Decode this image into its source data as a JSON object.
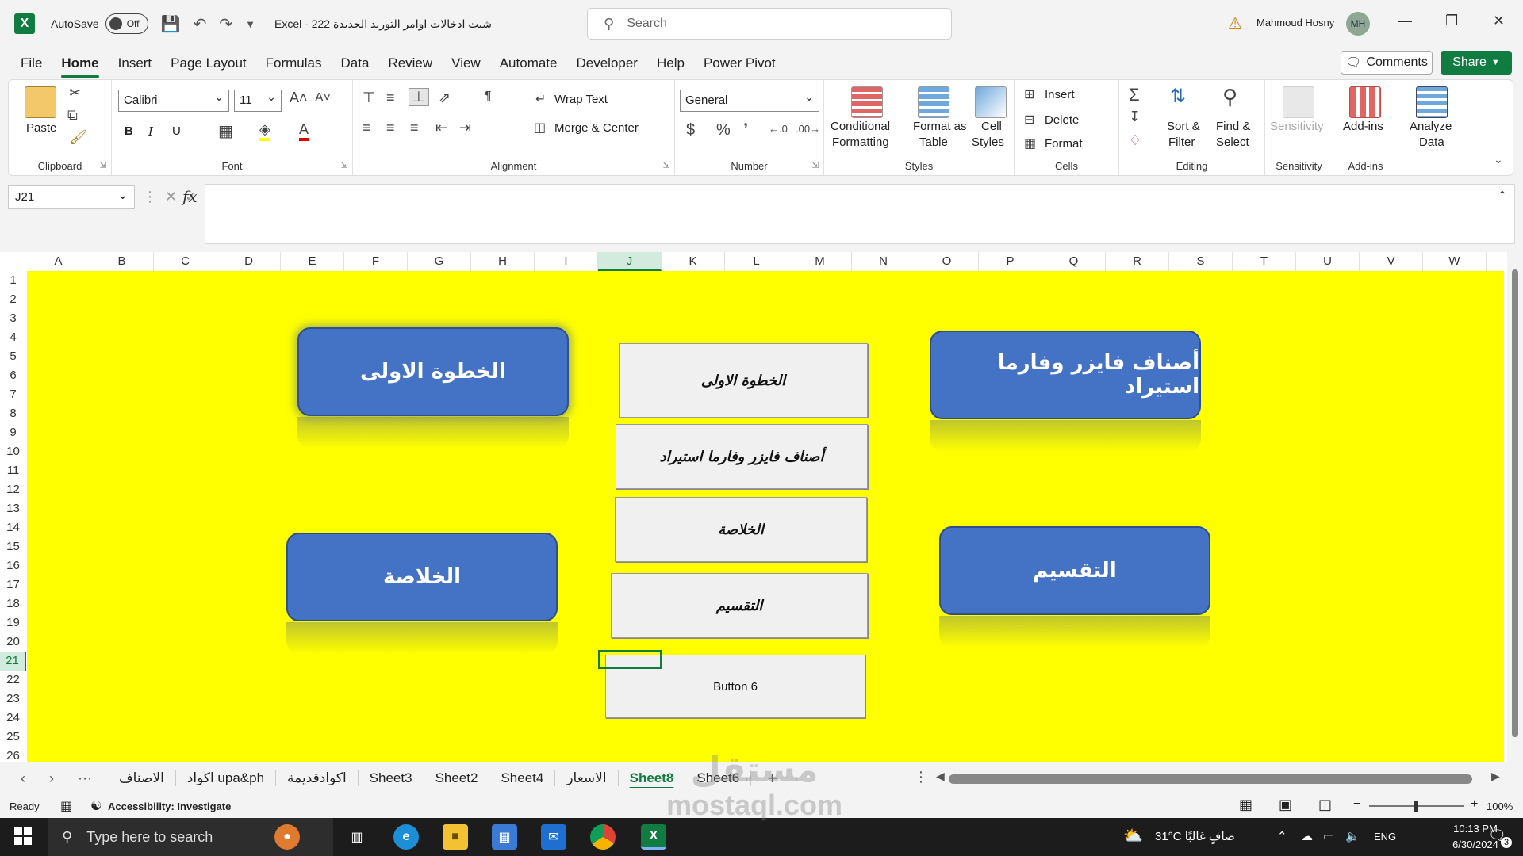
{
  "titlebar": {
    "autosave_label": "AutoSave",
    "autosave_state": "Off",
    "doc_title": "شيت ادخالات اوامر التوريد الجديدة 222  -  Excel",
    "search_placeholder": "Search",
    "user_name": "Mahmoud Hosny",
    "user_initials": "MH"
  },
  "menu": {
    "tabs": [
      "File",
      "Home",
      "Insert",
      "Page Layout",
      "Formulas",
      "Data",
      "Review",
      "View",
      "Automate",
      "Developer",
      "Help",
      "Power Pivot"
    ],
    "active": "Home",
    "comments": "Comments",
    "share": "Share"
  },
  "ribbon": {
    "clipboard": {
      "label": "Clipboard",
      "paste": "Paste"
    },
    "font": {
      "label": "Font",
      "name": "Calibri",
      "size": "11",
      "bold": "B",
      "italic": "I",
      "underline": "U"
    },
    "alignment": {
      "label": "Alignment",
      "wrap": "Wrap Text",
      "merge": "Merge & Center"
    },
    "number": {
      "label": "Number",
      "format": "General"
    },
    "styles": {
      "label": "Styles",
      "conditional_1": "Conditional",
      "conditional_2": "Formatting",
      "table_1": "Format as",
      "table_2": "Table",
      "cell_1": "Cell",
      "cell_2": "Styles"
    },
    "cells": {
      "label": "Cells",
      "insert": "Insert",
      "delete": "Delete",
      "format": "Format"
    },
    "editing": {
      "label": "Editing",
      "sort_1": "Sort &",
      "sort_2": "Filter",
      "find_1": "Find &",
      "find_2": "Select"
    },
    "sensitivity": {
      "label": "Sensitivity",
      "btn": "Sensitivity"
    },
    "addins": {
      "label": "Add-ins",
      "btn": "Add-ins"
    },
    "analyze": {
      "btn_1": "Analyze",
      "btn_2": "Data"
    }
  },
  "formula_bar": {
    "name_box": "J21",
    "fx": "fx"
  },
  "grid": {
    "columns": [
      "A",
      "B",
      "C",
      "D",
      "E",
      "F",
      "G",
      "H",
      "I",
      "J",
      "K",
      "L",
      "M",
      "N",
      "O",
      "P",
      "Q",
      "R",
      "S",
      "T",
      "U",
      "V",
      "W"
    ],
    "rows": [
      "1",
      "2",
      "3",
      "4",
      "5",
      "6",
      "7",
      "8",
      "9",
      "10",
      "11",
      "12",
      "13",
      "14",
      "15",
      "16",
      "17",
      "18",
      "19",
      "20",
      "21",
      "22",
      "23",
      "24",
      "25",
      "26"
    ],
    "active_column": "J",
    "active_row": "21",
    "sheet_bg": "#ffff00"
  },
  "shapes": {
    "step1": "الخطوة الاولى",
    "pfizer": "أصناف فايزر وفارما استيراد",
    "summary": "الخلاصة",
    "division": "التقسيم"
  },
  "form_buttons": {
    "b1": "الخطوة الاولى",
    "b2": "أصناف فايزر وفارما استيراد",
    "b3": "الخلاصة",
    "b4": "التقسيم",
    "b5": "Button 6"
  },
  "sheet_tabs": [
    "الاصناف",
    "اكواد upa&ph",
    "اكوادقديمة",
    "Sheet3",
    "Sheet2",
    "Sheet4",
    "الاسعار",
    "Sheet8",
    "Sheet6"
  ],
  "active_sheet": "Sheet8",
  "status": {
    "ready": "Ready",
    "accessibility": "Accessibility: Investigate",
    "zoom": "100%"
  },
  "taskbar": {
    "search": "Type here to search",
    "weather": "31°C  صافٍ غالبًا",
    "lang": "ENG",
    "time": "10:13 PM",
    "date": "6/30/2024",
    "notif_count": "3"
  },
  "watermark": {
    "line1": "مستقل",
    "line2": "mostaql.com"
  }
}
